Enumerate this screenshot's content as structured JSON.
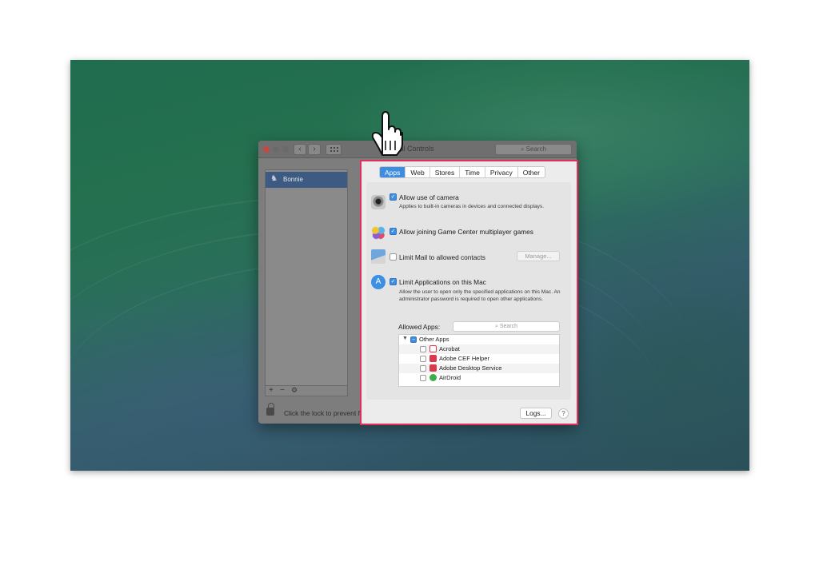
{
  "window": {
    "title": "Parental Controls",
    "search_placeholder": "Search",
    "nav_back": "‹",
    "nav_forward": "›"
  },
  "sidebar": {
    "users": [
      {
        "name": "Bonnie",
        "selected": true
      }
    ],
    "footer_buttons": [
      "+",
      "−",
      "⚙"
    ]
  },
  "lock": {
    "text": "Click the lock to prevent further changes."
  },
  "tabs": [
    {
      "label": "Apps",
      "active": true
    },
    {
      "label": "Web",
      "active": false
    },
    {
      "label": "Stores",
      "active": false
    },
    {
      "label": "Time",
      "active": false
    },
    {
      "label": "Privacy",
      "active": false
    },
    {
      "label": "Other",
      "active": false
    }
  ],
  "settings": {
    "camera": {
      "label": "Allow use of camera",
      "checked": true,
      "description": "Applies to built-in cameras in devices and connected displays."
    },
    "game_center": {
      "label": "Allow joining Game Center multiplayer games",
      "checked": true
    },
    "mail": {
      "label": "Limit Mail to allowed contacts",
      "checked": false,
      "manage_label": "Manage..."
    },
    "applications": {
      "label": "Limit Applications on this Mac",
      "checked": true,
      "description": "Allow the user to open only the specified applications on this Mac. An administrator password is required to open other applications."
    }
  },
  "allowed_apps": {
    "label": "Allowed Apps:",
    "search_placeholder": "Search",
    "group": "Other Apps",
    "items": [
      {
        "name": "Acrobat",
        "checked": false,
        "color": "#d9394a"
      },
      {
        "name": "Adobe CEF Helper",
        "checked": false,
        "color": "#d9394a"
      },
      {
        "name": "Adobe Desktop Service",
        "checked": false,
        "color": "#d9394a"
      },
      {
        "name": "AirDroid",
        "checked": false,
        "color": "#3cae49"
      }
    ]
  },
  "footer": {
    "logs_label": "Logs...",
    "help_label": "?"
  },
  "colors": {
    "highlight_border": "#e0305a",
    "accent": "#3f8de0"
  }
}
